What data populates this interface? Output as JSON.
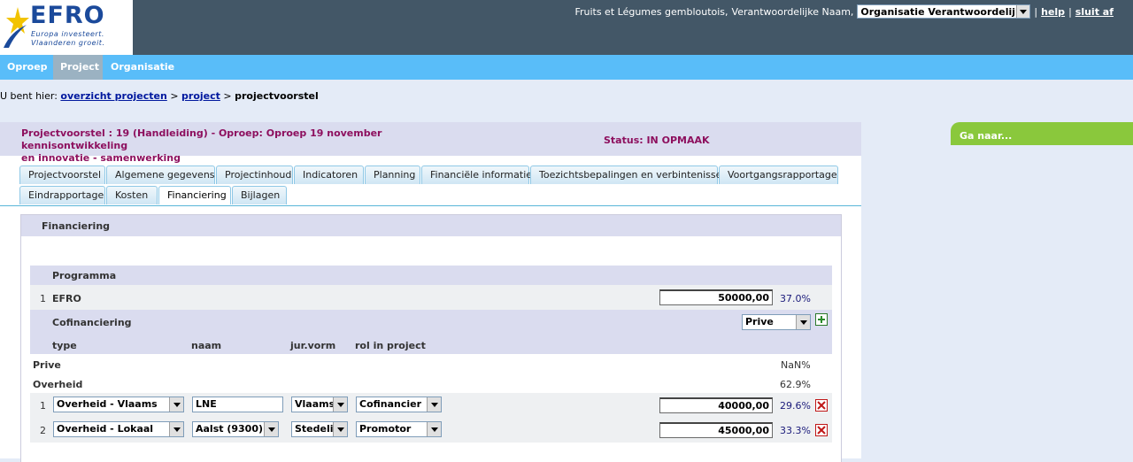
{
  "header": {
    "logo": {
      "word": "EFRO",
      "tagline1": "Europa investeert.",
      "tagline2": "Vlaanderen groeit."
    },
    "user_label": "Fruits et Légumes gembloutois,",
    "role_label": "Verantwoordelijke Naam,",
    "org_select": "Organisatie Verantwoordelijke",
    "help": "help",
    "logout": "sluit af",
    "separator": "|"
  },
  "nav": {
    "items": [
      "Oproep",
      "Project",
      "Organisatie"
    ],
    "active": "Project"
  },
  "breadcrumb": {
    "prefix": "U bent hier:",
    "link1": "overzicht projecten",
    "sep": ">",
    "link2": "project",
    "current": "projectvoorstel"
  },
  "goto": {
    "label": "Ga naar..."
  },
  "project": {
    "title_line1": "Projectvoorstel : 19 (Handleiding) - Oproep: Oproep 19 november kennisontwikkeling",
    "title_line2": "en innovatie - samenwerking",
    "status": "Status: IN OPMAAK"
  },
  "tabs_row1": [
    "Projectvoorstel",
    "Algemene gegevens",
    "Projectinhoud",
    "Indicatoren",
    "Planning",
    "Financiële informatie",
    "Toezichtsbepalingen en verbintenissen",
    "Voortgangsrapportage"
  ],
  "tabs_row2": [
    "Eindrapportage",
    "Kosten",
    "Financiering",
    "Bijlagen"
  ],
  "active_tab": "Financiering",
  "section": {
    "title": "Financiering",
    "programma": {
      "header": "Programma",
      "row": {
        "index": "1",
        "name": "EFRO",
        "amount": "50000,00",
        "pct": "37.0%"
      }
    },
    "cofinanciering": {
      "header": "Cofinanciering",
      "type_select": "Prive",
      "columns": [
        "type",
        "naam",
        "jur.vorm",
        "rol in project"
      ],
      "groups": [
        {
          "label": "Prive",
          "pct": "NaN%"
        },
        {
          "label": "Overheid",
          "pct": "62.9%"
        }
      ],
      "rows": [
        {
          "index": "1",
          "type": "Overheid - Vlaams",
          "naam": "LNE",
          "jurvorm": "Vlaams",
          "rol": "Cofinancier",
          "amount": "40000,00",
          "pct": "29.6%"
        },
        {
          "index": "2",
          "type": "Overheid - Lokaal",
          "naam": "Aalst (9300)",
          "jurvorm": "Stedelij",
          "rol": "Promotor",
          "amount": "45000,00",
          "pct": "33.3%"
        }
      ]
    }
  },
  "colors": {
    "header_bg": "#435767",
    "nav_bg": "#59bdf9",
    "accent_title": "#8d0f5e",
    "goto_bg": "#8ac83c",
    "link": "#00189e"
  }
}
